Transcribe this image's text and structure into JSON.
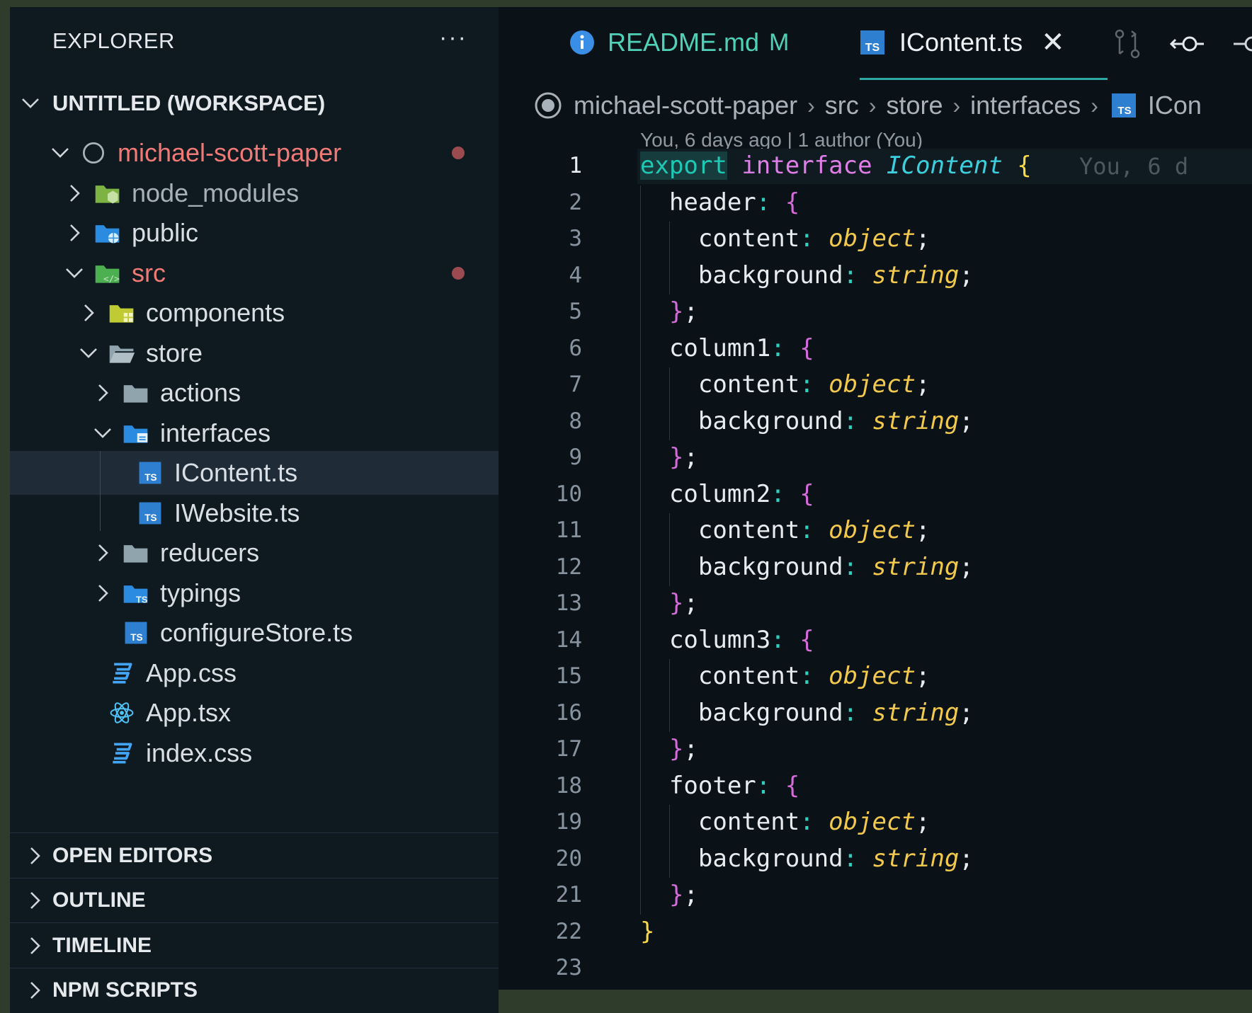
{
  "sidebar": {
    "title": "EXPLORER",
    "more_label": "···",
    "workspace_label": "UNTITLED (WORKSPACE)",
    "tree": [
      {
        "name": "michael-scott-paper",
        "depth": 0,
        "open": true,
        "icon": "repo-circle-icon",
        "modified": true,
        "style": "red"
      },
      {
        "name": "node_modules",
        "depth": 1,
        "open": false,
        "icon": "node-folder-icon",
        "style": "muted"
      },
      {
        "name": "public",
        "depth": 1,
        "open": false,
        "icon": "public-folder-icon"
      },
      {
        "name": "src",
        "depth": 1,
        "open": true,
        "icon": "src-folder-icon",
        "modified": true,
        "style": "red"
      },
      {
        "name": "components",
        "depth": 2,
        "open": false,
        "icon": "components-folder-icon"
      },
      {
        "name": "store",
        "depth": 2,
        "open": true,
        "icon": "folder-open-icon"
      },
      {
        "name": "actions",
        "depth": 3,
        "open": false,
        "icon": "folder-icon"
      },
      {
        "name": "interfaces",
        "depth": 3,
        "open": true,
        "icon": "interfaces-folder-icon"
      },
      {
        "name": "IContent.ts",
        "depth": 4,
        "icon": "ts-file-icon",
        "selected": true
      },
      {
        "name": "IWebsite.ts",
        "depth": 4,
        "icon": "ts-file-icon"
      },
      {
        "name": "reducers",
        "depth": 3,
        "open": false,
        "icon": "folder-icon"
      },
      {
        "name": "typings",
        "depth": 3,
        "open": false,
        "icon": "ts-folder-icon"
      },
      {
        "name": "configureStore.ts",
        "depth": 3,
        "icon": "ts-file-icon",
        "leaf": true
      },
      {
        "name": "App.css",
        "depth": 2,
        "icon": "css-file-icon",
        "leaf": true
      },
      {
        "name": "App.tsx",
        "depth": 2,
        "icon": "react-file-icon",
        "leaf": true
      },
      {
        "name": "index.css",
        "depth": 2,
        "icon": "css-file-icon",
        "leaf": true
      }
    ],
    "panels": [
      "OPEN EDITORS",
      "OUTLINE",
      "TIMELINE",
      "NPM SCRIPTS"
    ]
  },
  "tabs": {
    "readme": {
      "label": "README.md",
      "badge": "M"
    },
    "active": {
      "label": "IContent.ts",
      "close": "✕"
    }
  },
  "breadcrumbs": [
    "michael-scott-paper",
    "src",
    "store",
    "interfaces",
    "ICon"
  ],
  "blame_header": "You, 6 days ago | 1 author (You)",
  "inline_blame": "You, 6 d",
  "code": {
    "line_count": 23,
    "current_line": 1,
    "keyword_export": "export",
    "keyword_interface": "interface",
    "interface_name": "IContent",
    "fields": [
      "header",
      "column1",
      "column2",
      "column3",
      "footer"
    ],
    "props": [
      {
        "name": "content",
        "type": "object"
      },
      {
        "name": "background",
        "type": "string"
      }
    ]
  },
  "colors": {
    "accent": "#2ea8a3",
    "sidebar_bg": "#0e1920",
    "editor_bg": "#0b1217",
    "modified": "#ef7a76"
  }
}
